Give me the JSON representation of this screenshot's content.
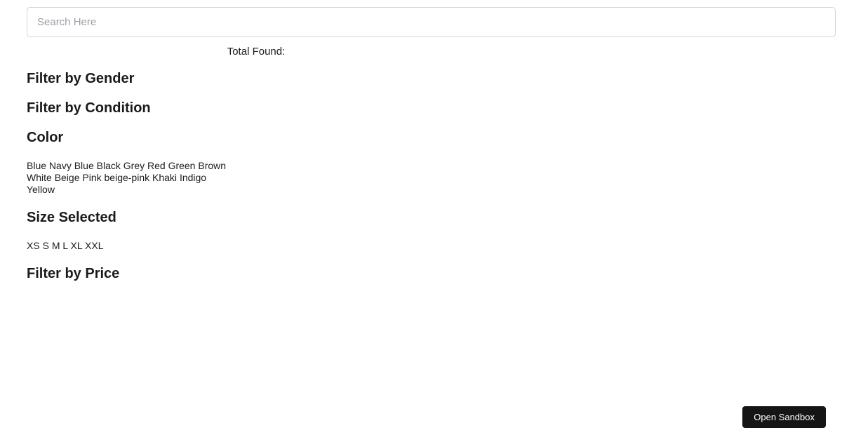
{
  "search": {
    "placeholder": "Search Here",
    "value": ""
  },
  "results": {
    "total_found_label": "Total Found:",
    "count": ""
  },
  "filters": {
    "gender": {
      "heading": "Filter by Gender"
    },
    "condition": {
      "heading": "Filter by Condition"
    },
    "color": {
      "heading": "Color",
      "options": [
        "Blue",
        "Navy Blue",
        "Black",
        "Grey",
        "Red",
        "Green",
        "Brown",
        "White",
        "Beige",
        "Pink",
        "beige-pink",
        "Khaki",
        "Indigo",
        "Yellow"
      ]
    },
    "size": {
      "heading": "Size Selected",
      "options": [
        "XS",
        "S",
        "M",
        "L",
        "XL",
        "XXL"
      ]
    },
    "price": {
      "heading": "Filter by Price"
    }
  },
  "sandbox_button": {
    "label": "Open Sandbox",
    "background_color": "#151515",
    "text_color": "#ffffff"
  },
  "colors": {
    "page_background": "#ffffff",
    "text": "#1c1c1c",
    "input_border": "#ced4da",
    "placeholder": "#999fa6"
  }
}
